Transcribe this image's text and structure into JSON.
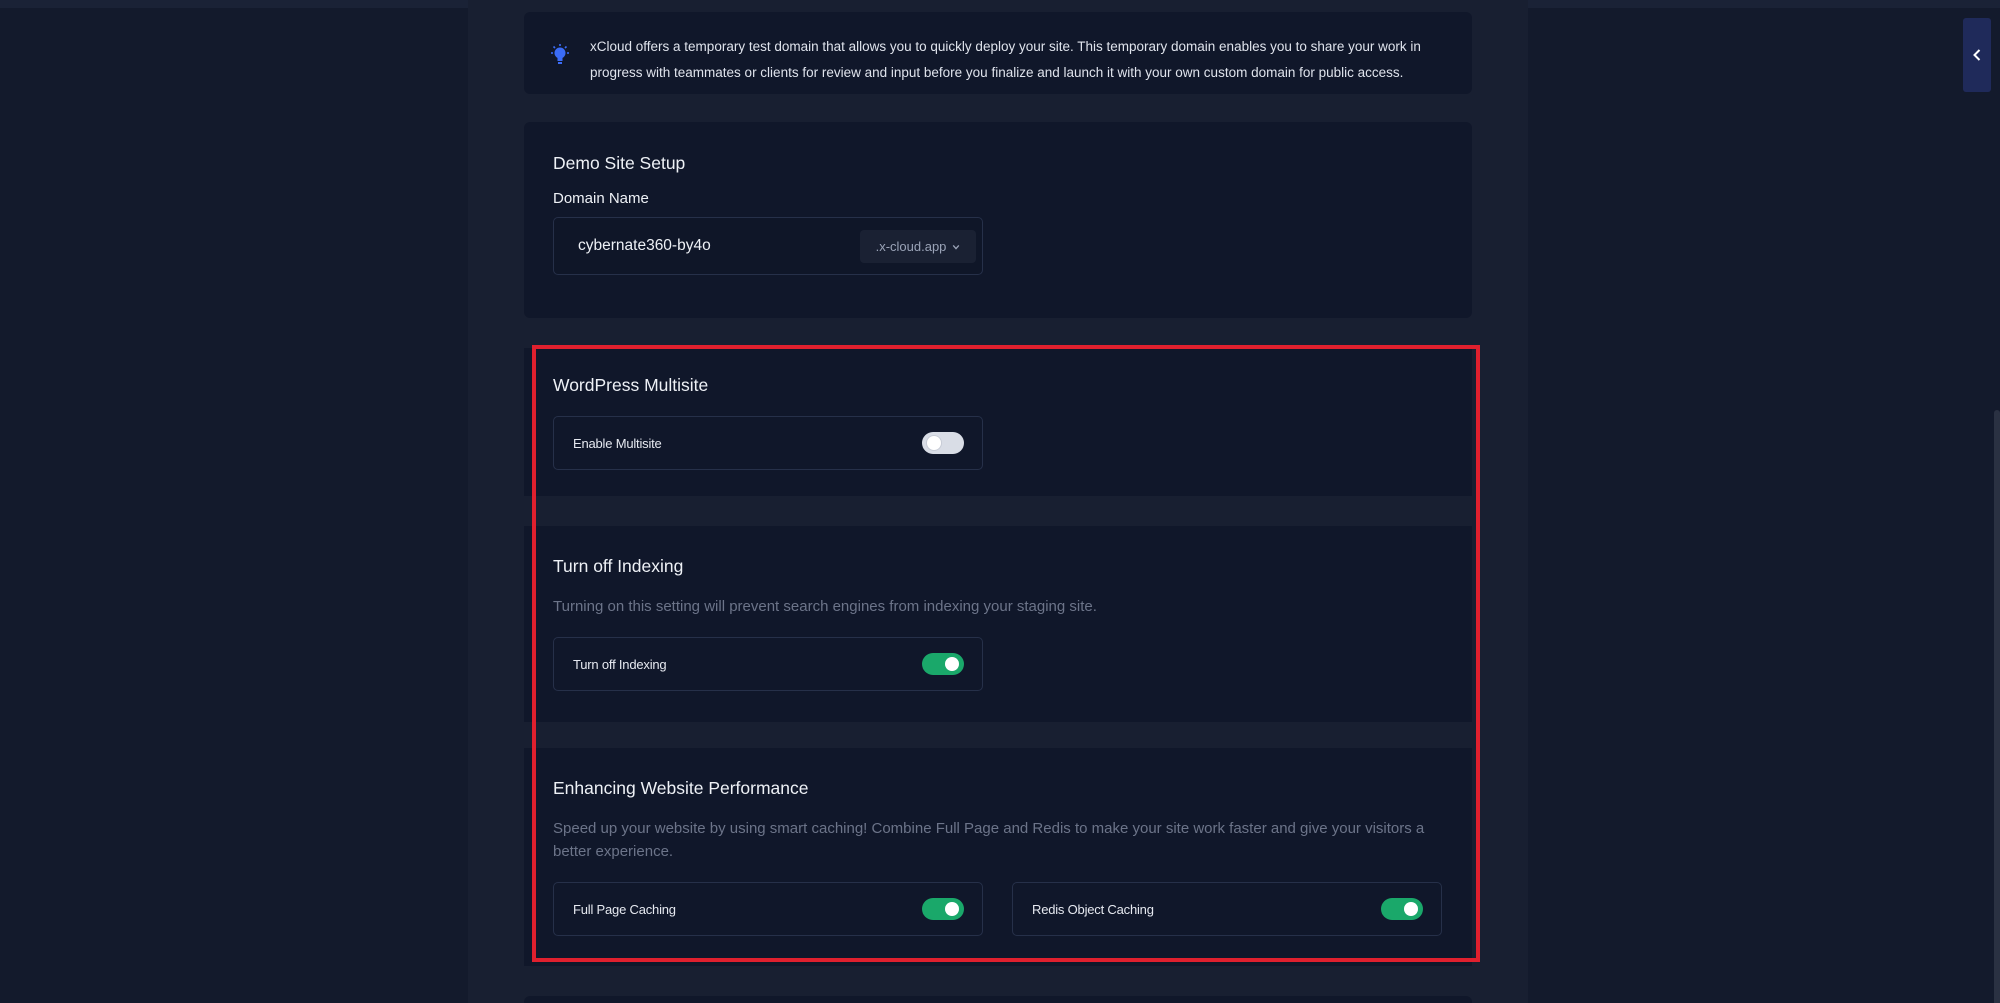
{
  "notice": {
    "text": "xCloud offers a temporary test domain that allows you to quickly deploy your site. This temporary domain enables you to share your work in progress with teammates or clients for review and input before you finalize and launch it with your own custom domain for public access.",
    "icon": "lightbulb-icon"
  },
  "demo_site": {
    "title": "Demo Site Setup",
    "domain_label": "Domain Name",
    "domain_value": "cybernate360-by4o",
    "domain_suffix": ".x-cloud.app"
  },
  "multisite": {
    "title": "WordPress Multisite",
    "toggle_label": "Enable Multisite",
    "enabled": false
  },
  "indexing": {
    "title": "Turn off Indexing",
    "description": "Turning on this setting will prevent search engines from indexing your staging site.",
    "toggle_label": "Turn off Indexing",
    "enabled": true
  },
  "performance": {
    "title": "Enhancing Website Performance",
    "description": "Speed up your website by using smart caching! Combine Full Page and Redis to make your site work faster and give your visitors a better experience.",
    "full_page_label": "Full Page Caching",
    "full_page_enabled": true,
    "redis_label": "Redis Object Caching",
    "redis_enabled": true
  },
  "colors": {
    "accent_green": "#1aa86a",
    "highlight_red": "#e0202e",
    "icon_blue": "#3b6cf6"
  }
}
